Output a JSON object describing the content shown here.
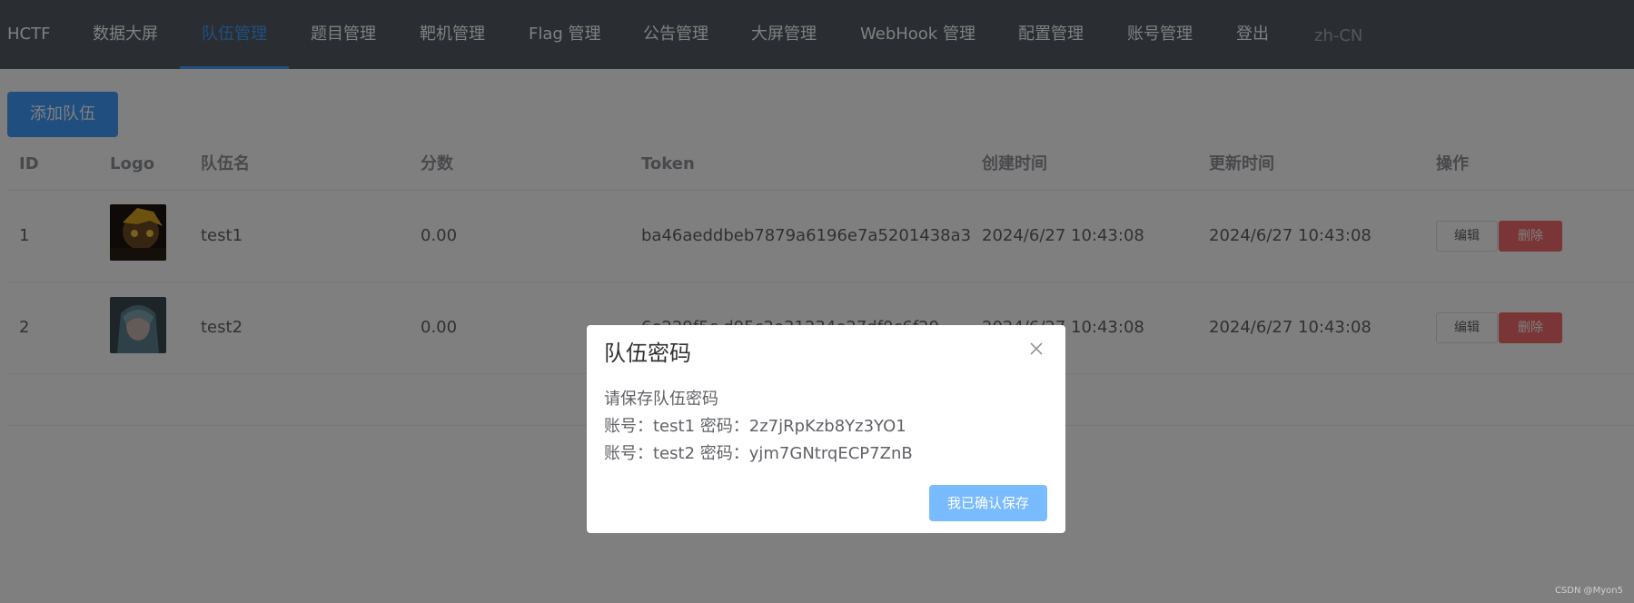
{
  "nav": {
    "brand": "HCTF",
    "items": [
      "数据大屏",
      "队伍管理",
      "题目管理",
      "靶机管理",
      "Flag 管理",
      "公告管理",
      "大屏管理",
      "WebHook 管理",
      "配置管理",
      "账号管理",
      "登出"
    ],
    "locale": "zh-CN",
    "active_index": 1
  },
  "toolbar": {
    "add_label": "添加队伍"
  },
  "table": {
    "headers": [
      "ID",
      "Logo",
      "队伍名",
      "分数",
      "Token",
      "创建时间",
      "更新时间",
      "操作"
    ],
    "rows": [
      {
        "id": "1",
        "name": "test1",
        "score": "0.00",
        "token": "ba46aeddbeb7879a6196e7a5201438a3",
        "created": "2024/6/27 10:43:08",
        "updated": "2024/6/27 10:43:08"
      },
      {
        "id": "2",
        "name": "test2",
        "score": "0.00",
        "token": "6e229f5c d95c2e31234e27df0c6f29",
        "created": "2024/6/27 10:43:08",
        "updated": "2024/6/27 10:43:08"
      }
    ],
    "edit_label": "编辑",
    "delete_label": "删除"
  },
  "dialog": {
    "title": "队伍密码",
    "message": "请保存队伍密码",
    "accounts": [
      "账号：test1 密码：2z7jRpKzb8Yz3YO1",
      "账号：test2 密码：yjm7GNtrqECP7ZnB"
    ],
    "confirm_label": "我已确认保存"
  },
  "watermark": "CSDN @Myon5",
  "colors": {
    "nav_bg": "#545c64",
    "primary": "#409eff",
    "danger": "#f56c6c"
  }
}
